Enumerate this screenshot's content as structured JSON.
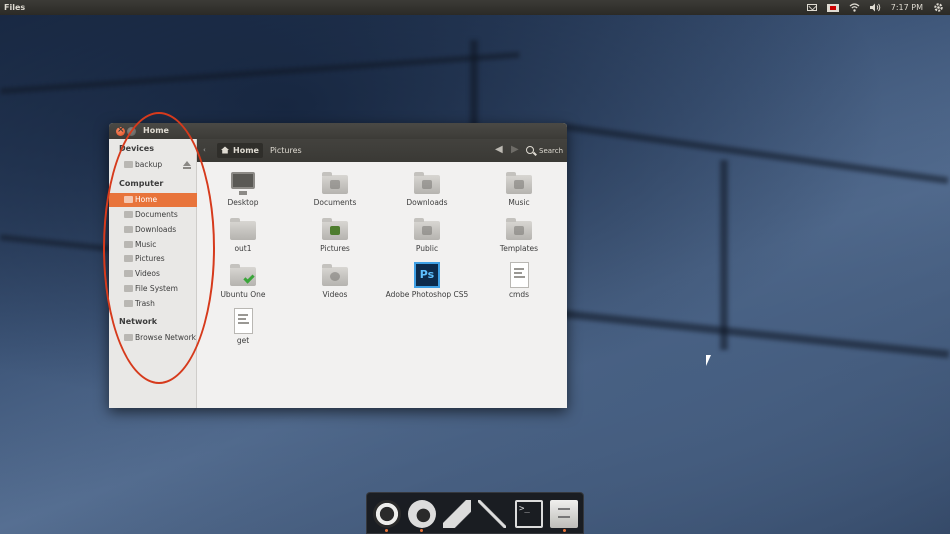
{
  "top_panel": {
    "app_title": "Files",
    "clock": "7:17 PM",
    "indicators": [
      "mail-icon",
      "keyboard-flag-icon",
      "wifi-icon",
      "volume-icon",
      "gear-icon"
    ]
  },
  "window": {
    "title": "Home",
    "toolbar": {
      "crumb_home": "Home",
      "crumb_next": "Pictures",
      "search_label": "Search"
    },
    "sidebar": {
      "sections": [
        {
          "heading": "Devices",
          "items": [
            {
              "label": "backup",
              "icon": "drive-icon",
              "eject": true
            }
          ]
        },
        {
          "heading": "Computer",
          "items": [
            {
              "label": "Home",
              "icon": "home-icon",
              "active": true
            },
            {
              "label": "Documents",
              "icon": "folder-icon"
            },
            {
              "label": "Downloads",
              "icon": "folder-icon"
            },
            {
              "label": "Music",
              "icon": "folder-icon"
            },
            {
              "label": "Pictures",
              "icon": "folder-icon"
            },
            {
              "label": "Videos",
              "icon": "folder-icon"
            },
            {
              "label": "File System",
              "icon": "drive-icon"
            },
            {
              "label": "Trash",
              "icon": "trash-icon"
            }
          ]
        },
        {
          "heading": "Network",
          "items": [
            {
              "label": "Browse Network",
              "icon": "network-icon"
            }
          ]
        }
      ]
    },
    "files": [
      {
        "name": "Desktop",
        "icon": "desktop-icon"
      },
      {
        "name": "Documents",
        "icon": "folder-documents-icon"
      },
      {
        "name": "Downloads",
        "icon": "folder-downloads-icon"
      },
      {
        "name": "Music",
        "icon": "folder-music-icon"
      },
      {
        "name": "out1",
        "icon": "folder-icon"
      },
      {
        "name": "Pictures",
        "icon": "folder-pictures-icon"
      },
      {
        "name": "Public",
        "icon": "folder-public-icon"
      },
      {
        "name": "Templates",
        "icon": "folder-templates-icon"
      },
      {
        "name": "Ubuntu One",
        "icon": "folder-ubuntu-one-icon"
      },
      {
        "name": "Videos",
        "icon": "folder-videos-icon"
      },
      {
        "name": "Adobe Photoshop CS5",
        "icon": "photoshop-icon",
        "badge": "Ps"
      },
      {
        "name": "cmds",
        "icon": "text-file-icon"
      },
      {
        "name": "get",
        "icon": "text-file-icon"
      }
    ]
  },
  "dock": {
    "items": [
      "ubuntu-icon",
      "firefox-icon",
      "gimp-icon",
      "inkscape-icon",
      "terminal-icon",
      "files-icon"
    ],
    "terminal_glyph": ">_"
  },
  "colors": {
    "accent": "#e8743b",
    "annotation": "#d63a1c",
    "panel": "#3c3b37"
  }
}
